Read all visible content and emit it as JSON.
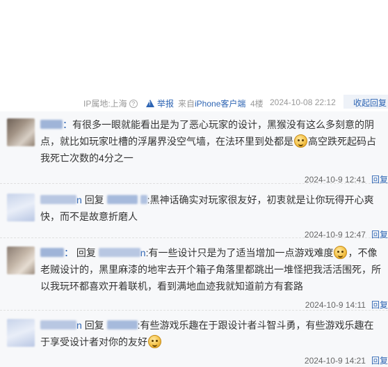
{
  "post_meta": {
    "ip_location": "IP属地:上海",
    "help_icon": "question-circle-icon",
    "report_label": "举报",
    "source_prefix": "来自",
    "source_link": "iPhone客户端",
    "floor": "4楼",
    "datetime": "2024-10-08 22:12",
    "collapse_label": "收起回复"
  },
  "replies": [
    {
      "author_suffix": "：",
      "is_reply": false,
      "target_suffix": "",
      "content_before_emoji": "有很多一眼就能看出是为了恶心玩家的设计，黑猴没有这么多刻意的阴点，就比如玩家吐槽的浮屠界没空气墙，在法环里到处都是",
      "emoji": "smiley-emoji",
      "content_after_emoji": "高空跌死起码占我死亡次数的4分之一",
      "time": "2024-10-9 12:41",
      "reply_label": "回复"
    },
    {
      "author_suffix": "n",
      "is_reply": true,
      "reply_word": "回复",
      "target_suffix": "",
      "content_before_emoji": ":黑神话确实对玩家很友好，初衷就是让你玩得开心爽快，而不是故意折磨人",
      "emoji": "",
      "content_after_emoji": "",
      "time": "2024-10-9 12:47",
      "reply_label": "回复"
    },
    {
      "author_suffix": "：",
      "is_reply": true,
      "reply_word": "回复",
      "target_suffix": "n",
      "content_before_emoji": ":有一些设计只是为了适当增加一点游戏难度",
      "emoji": "smiley-emoji",
      "content_after_emoji": "，不像老贼设计的，黑里麻漆的地牢去开个箱子角落里都跳出一堆怪把我活活围死，所以我玩环都喜欢开着联机，看到满地血迹我就知道前方有套路",
      "time": "2024-10-9 14:11",
      "reply_label": "回复"
    },
    {
      "author_suffix": "n",
      "is_reply": true,
      "reply_word": "回复",
      "target_suffix": "",
      "content_before_emoji": ":有些游戏乐趣在于跟设计者斗智斗勇，有些游戏乐趣在于享受设计者对你的友好",
      "emoji": "smiley-emoji",
      "content_after_emoji": "",
      "time": "2024-10-9 14:21",
      "reply_label": "回复"
    }
  ]
}
